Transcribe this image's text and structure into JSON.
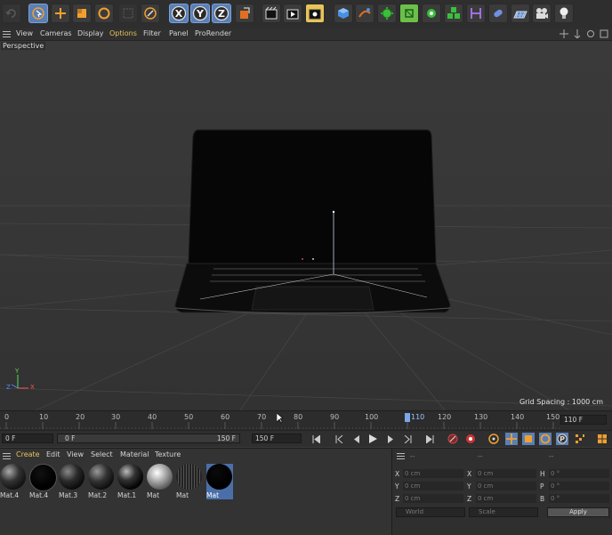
{
  "menubar": {
    "items": [
      {
        "label": "View",
        "active": false
      },
      {
        "label": "Cameras",
        "active": false
      },
      {
        "label": "Display",
        "active": false
      },
      {
        "label": "Options",
        "active": true
      },
      {
        "label": "Filter",
        "active": false
      },
      {
        "label": "Panel",
        "active": false
      },
      {
        "label": "ProRender",
        "active": false
      }
    ]
  },
  "toolbar": {
    "axis_x": "X",
    "axis_y": "Y",
    "axis_z": "Z"
  },
  "viewport": {
    "label": "Perspective",
    "grid_spacing": "Grid Spacing : 1000 cm",
    "axis_y": "Y",
    "axis_z": "Z",
    "axis_x": "X"
  },
  "timeline": {
    "ticks": [
      "0",
      "10",
      "20",
      "30",
      "40",
      "50",
      "60",
      "70",
      "80",
      "90",
      "100",
      "110",
      "120",
      "130",
      "140",
      "150"
    ],
    "current_frame": "110 F"
  },
  "transport": {
    "start": "0 F",
    "range_start": "0 F",
    "range_end": "150 F",
    "end": "150 F"
  },
  "materials": {
    "menu": [
      {
        "label": "Create",
        "active": true
      },
      {
        "label": "Edit",
        "active": false
      },
      {
        "label": "View",
        "active": false
      },
      {
        "label": "Select",
        "active": false
      },
      {
        "label": "Material",
        "active": false
      },
      {
        "label": "Texture",
        "active": false
      }
    ],
    "items": [
      {
        "name": "Mat.4",
        "style": "dark"
      },
      {
        "name": "Mat.4",
        "style": "black"
      },
      {
        "name": "Mat.3",
        "style": "dark"
      },
      {
        "name": "Mat.2",
        "style": "dark"
      },
      {
        "name": "Mat.1",
        "style": "dark"
      },
      {
        "name": "Mat",
        "style": "silver"
      },
      {
        "name": "Mat",
        "style": "mesh"
      },
      {
        "name": "Mat",
        "style": "black",
        "selected": true
      }
    ]
  },
  "attributes": {
    "header_1": "--",
    "header_2": "--",
    "header_3": "--",
    "pos_x": "X",
    "pos_y": "Y",
    "pos_z": "Z",
    "size_x": "X",
    "size_y": "Y",
    "size_z": "Z",
    "rot_h": "H",
    "rot_p": "P",
    "rot_b": "B",
    "val_cm": "0 cm",
    "val_deg": "0 °",
    "coord_system": "World",
    "mode": "Scale",
    "apply": "Apply"
  },
  "colors": {
    "accent": "#e8c35a",
    "active_blue": "#5a7fb5",
    "viewport": "#3a3a3a"
  }
}
